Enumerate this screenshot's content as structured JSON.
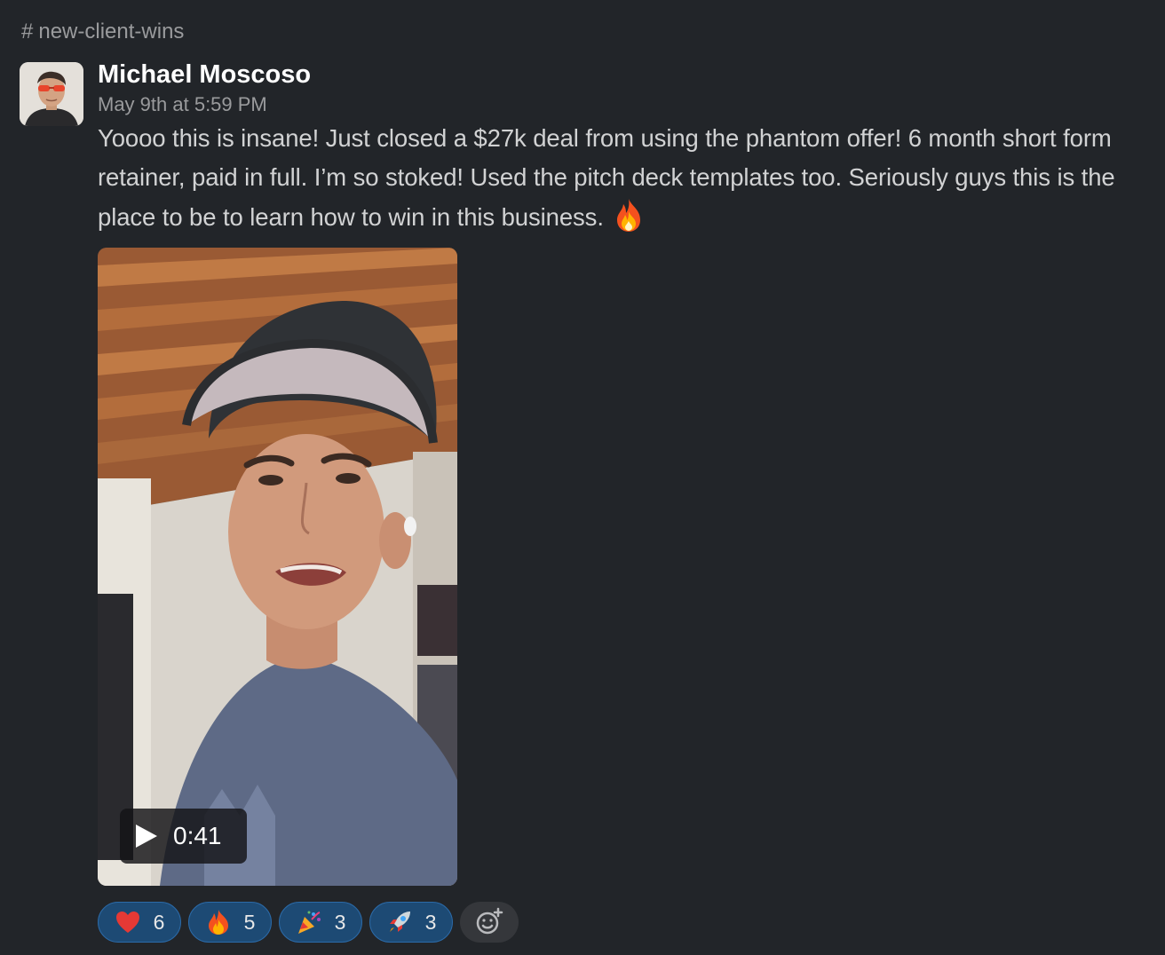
{
  "channel": {
    "hash": "#",
    "name": "new-client-wins"
  },
  "message": {
    "sender": "Michael Moscoso",
    "timestamp": "May 9th at 5:59 PM",
    "text": "Yoooo this is insane! Just closed a $27k deal from using the phantom offer! 6 month short form retainer, paid in full. I’m so stoked! Used the pitch deck templates too. Seriously guys this is the place to be to learn how to win in this business.",
    "inline_emoji": "fire-emoji"
  },
  "video": {
    "duration": "0:41"
  },
  "reactions": [
    {
      "emoji": "heart-emoji",
      "count": "6"
    },
    {
      "emoji": "fire-emoji",
      "count": "5"
    },
    {
      "emoji": "party-popper-emoji",
      "count": "3"
    },
    {
      "emoji": "rocket-emoji",
      "count": "3"
    }
  ],
  "colors": {
    "background": "#222529",
    "reaction_bg": "#1d4a74",
    "reaction_border": "#2b6aa8",
    "text": "#d1d2d3",
    "muted": "#9a9b9d"
  }
}
